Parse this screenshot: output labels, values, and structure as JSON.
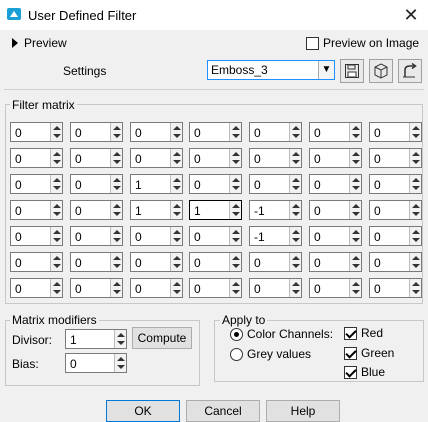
{
  "window": {
    "title": "User Defined Filter",
    "close_glyph": "✕"
  },
  "preview": {
    "toggle_label": "Preview",
    "on_image_label": "Preview on Image",
    "on_image_checked": false
  },
  "settings": {
    "label": "Settings",
    "selected": "Emboss_3"
  },
  "matrix": {
    "title": "Filter matrix",
    "rows": [
      [
        "0",
        "0",
        "0",
        "0",
        "0",
        "0",
        "0"
      ],
      [
        "0",
        "0",
        "0",
        "0",
        "0",
        "0",
        "0"
      ],
      [
        "0",
        "0",
        "1",
        "0",
        "0",
        "0",
        "0"
      ],
      [
        "0",
        "0",
        "1",
        "1",
        "-1",
        "0",
        "0"
      ],
      [
        "0",
        "0",
        "0",
        "0",
        "-1",
        "0",
        "0"
      ],
      [
        "0",
        "0",
        "0",
        "0",
        "0",
        "0",
        "0"
      ],
      [
        "0",
        "0",
        "0",
        "0",
        "0",
        "0",
        "0"
      ]
    ]
  },
  "modifiers": {
    "title": "Matrix modifiers",
    "divisor_label": "Divisor:",
    "divisor_value": "1",
    "compute_label": "Compute",
    "bias_label": "Bias:",
    "bias_value": "0"
  },
  "apply": {
    "title": "Apply to",
    "color_channels_label": "Color Channels:",
    "grey_values_label": "Grey values",
    "red_label": "Red",
    "green_label": "Green",
    "blue_label": "Blue"
  },
  "buttons": {
    "ok": "OK",
    "cancel": "Cancel",
    "help": "Help"
  },
  "colors": {
    "accent": "#0078d7",
    "icon_blue": "#1a9fd6"
  }
}
